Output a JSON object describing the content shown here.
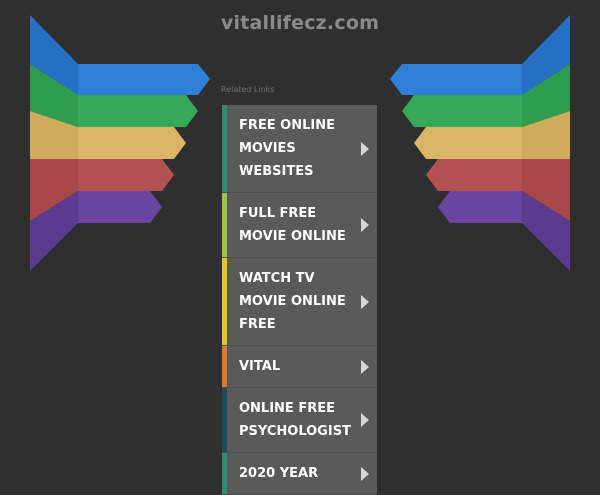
{
  "site": {
    "title": "vitallifecz.com"
  },
  "related_label": "Related Links",
  "links": [
    {
      "label": "FREE ONLINE MOVIES WEBSITES",
      "color": "#2e8d78"
    },
    {
      "label": "FULL FREE MOVIE ONLINE",
      "color": "#9fc24a"
    },
    {
      "label": "WATCH TV MOVIE ONLINE FREE",
      "color": "#e1c43d"
    },
    {
      "label": "VITAL",
      "color": "#e07a2c"
    },
    {
      "label": "ONLINE FREE PSYCHOLOGIST",
      "color": "#1e4a57"
    },
    {
      "label": "2020 YEAR",
      "color": "#2e8d78"
    }
  ],
  "ribbon_colors": [
    "#2570c4",
    "#2f9c4e",
    "#cfa95a",
    "#a84848",
    "#5c3a90"
  ]
}
